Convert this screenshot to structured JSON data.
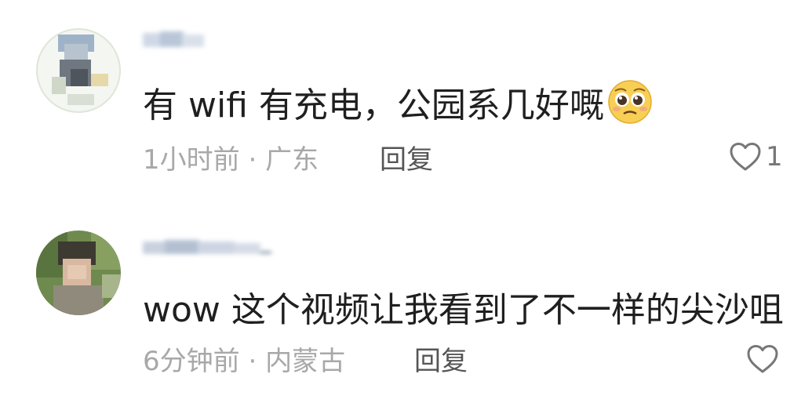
{
  "comments": [
    {
      "username": "",
      "text": "有 wifi 有充电，公园系几好嘅",
      "emoji": "pleading-face",
      "time": "1小时前",
      "location": "广东",
      "reply_label": "回复",
      "likes": "1"
    },
    {
      "username": "",
      "text": "wow 这个视频让我看到了不一样的尖沙咀",
      "time": "6分钟前",
      "location": "内蒙古",
      "reply_label": "回复",
      "likes": ""
    }
  ],
  "meta_separator": " · ",
  "colors": {
    "text": "#1f1f1f",
    "meta": "#a8a8a8",
    "reply": "#555555",
    "icon": "#777777"
  }
}
